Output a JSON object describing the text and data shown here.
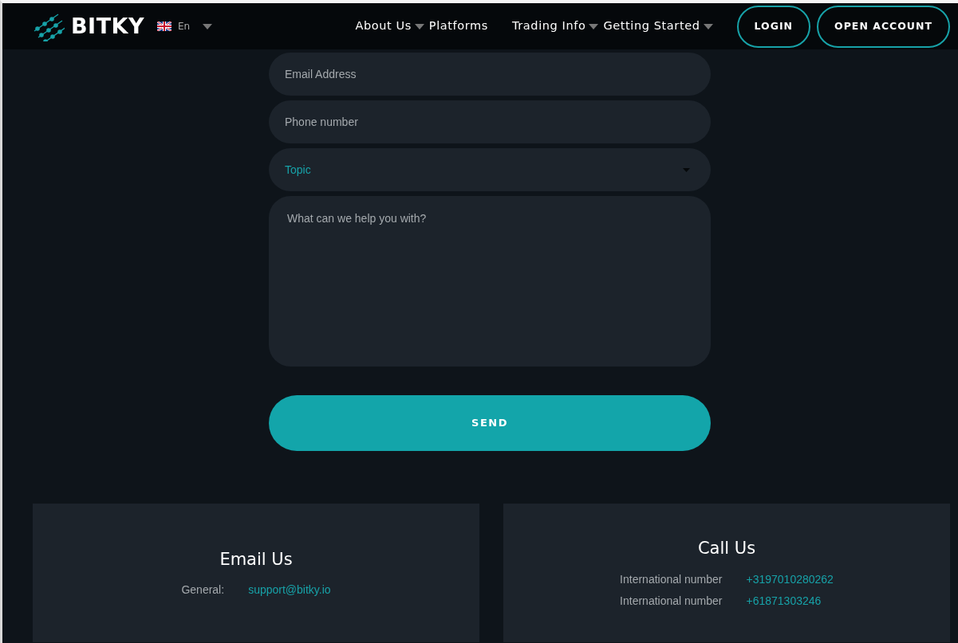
{
  "header": {
    "brand": "BITKY",
    "language": "En",
    "nav": [
      {
        "label": "About Us",
        "dropdown": true
      },
      {
        "label": "Platforms",
        "dropdown": false
      },
      {
        "label": "Trading Info",
        "dropdown": true
      },
      {
        "label": "Getting Started",
        "dropdown": true
      }
    ],
    "buttons": [
      "LOGIN",
      "OPEN ACCOUNT"
    ]
  },
  "form": {
    "fields": [
      {
        "kind": "text",
        "placeholder": "Email Address"
      },
      {
        "kind": "text",
        "placeholder": "Phone number"
      },
      {
        "kind": "select",
        "value": "Topic"
      },
      {
        "kind": "textarea",
        "placeholder": "What can we help you with?"
      }
    ],
    "submit": "SEND"
  },
  "contact_cards": [
    {
      "title": "Email Us",
      "rows": [
        {
          "label": "General:",
          "value": "support@bitky.io"
        }
      ]
    },
    {
      "title": "Call Us",
      "rows": [
        {
          "label": "International number",
          "value": "+3197010280262"
        },
        {
          "label": "International number",
          "value": "+61871303246"
        }
      ]
    }
  ]
}
